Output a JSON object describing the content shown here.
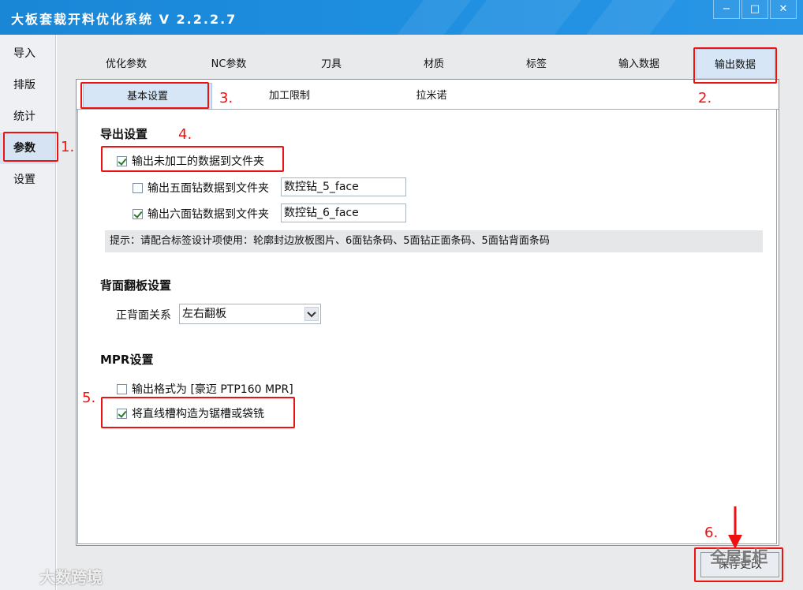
{
  "window": {
    "title": "大板套裁开料优化系统 V 2.2.2.7",
    "buttons": [
      "−",
      "□",
      "✕"
    ]
  },
  "leftnav": {
    "items": [
      {
        "label": "导入"
      },
      {
        "label": "排版"
      },
      {
        "label": "统计"
      },
      {
        "label": "参数",
        "active": true
      },
      {
        "label": "设置"
      }
    ]
  },
  "tabs": [
    {
      "label": "优化参数"
    },
    {
      "label": "NC参数"
    },
    {
      "label": "刀具"
    },
    {
      "label": "材质"
    },
    {
      "label": "标签"
    },
    {
      "label": "输入数据"
    },
    {
      "label": "输出数据",
      "selected": true
    }
  ],
  "subtabs": [
    {
      "label": "基本设置",
      "selected": true
    },
    {
      "label": "加工限制"
    },
    {
      "label": "拉米诺"
    }
  ],
  "export": {
    "title": "导出设置",
    "unprocessed": {
      "label": "输出未加工的数据到文件夹",
      "checked": true
    },
    "five_face": {
      "label": "输出五面钻数据到文件夹",
      "checked": false,
      "value": "数控钻_5_face"
    },
    "six_face": {
      "label": "输出六面钻数据到文件夹",
      "checked": true,
      "value": "数控钻_6_face"
    },
    "hint": "提示：请配合标签设计项使用：轮廓封边放板图片、6面钻条码、5面钻正面条码、5面钻背面条码"
  },
  "flip": {
    "title": "背面翻板设置",
    "label": "正背面关系",
    "value": "左右翻板"
  },
  "mpr": {
    "title": "MPR设置",
    "format": {
      "label": "输出格式为 [豪迈 PTP160 MPR]",
      "checked": false
    },
    "groove": {
      "label": "将直线槽构造为锯槽或袋铣",
      "checked": true
    }
  },
  "save_label": "保存更改",
  "annotations": [
    "1.",
    "2.",
    "3.",
    "4.",
    "5.",
    "6."
  ],
  "watermarks": {
    "left": "大数跨境",
    "right": "全屋E柜"
  },
  "colors": {
    "titlebar": "#1a86d6",
    "annotation": "#ee1111",
    "selected_tab": "#d6e6f7"
  }
}
